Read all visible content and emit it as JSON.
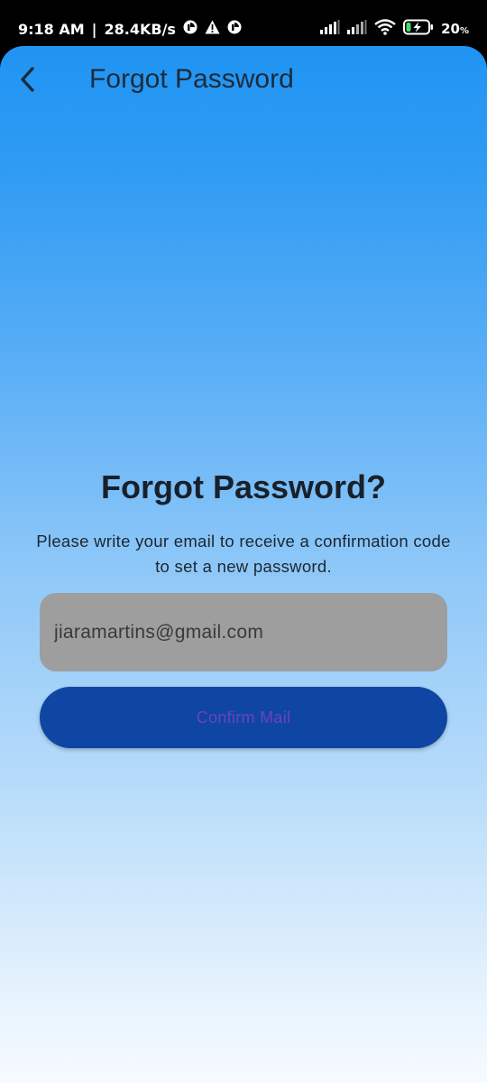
{
  "status_bar": {
    "time": "9:18 AM",
    "separator": "|",
    "network_speed": "28.4KB/s",
    "left_icons": [
      "circle-app-icon",
      "warning-icon",
      "circle-app-icon"
    ],
    "right_icons": [
      "signal-icon",
      "signal-icon",
      "wifi-icon",
      "battery-charging-icon"
    ],
    "battery_level": "20",
    "battery_unit": "%"
  },
  "app_bar": {
    "back_icon": "chevron-left-icon",
    "title": "Forgot Password"
  },
  "main": {
    "heading": "Forgot Password?",
    "description": "Please write your email to receive a confirmation code to set a new password.",
    "email_value": "jiaramartins@gmail.com",
    "confirm_label": "Confirm Mail"
  },
  "colors": {
    "gradient_top": "#2094f3",
    "gradient_bottom": "#f6fbff",
    "field_bg": "#9e9e9e",
    "button_bg": "#0f45a3",
    "button_text": "#6a44b8",
    "battery_fill": "#4cd964"
  }
}
